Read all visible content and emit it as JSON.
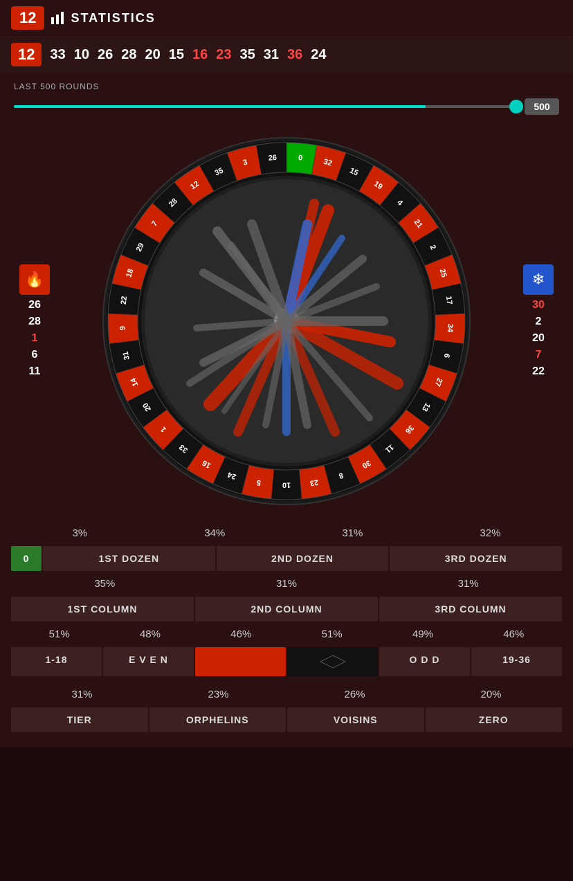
{
  "topbar": {
    "number": "12",
    "stats_icon": "📊",
    "title": "STATISTICS"
  },
  "history": {
    "current": "12",
    "numbers": [
      {
        "value": "33",
        "color": "black"
      },
      {
        "value": "10",
        "color": "black"
      },
      {
        "value": "26",
        "color": "black"
      },
      {
        "value": "28",
        "color": "black"
      },
      {
        "value": "20",
        "color": "black"
      },
      {
        "value": "15",
        "color": "black"
      },
      {
        "value": "16",
        "color": "red"
      },
      {
        "value": "23",
        "color": "red"
      },
      {
        "value": "35",
        "color": "black"
      },
      {
        "value": "31",
        "color": "black"
      },
      {
        "value": "36",
        "color": "red"
      },
      {
        "value": "24",
        "color": "black"
      }
    ]
  },
  "slider": {
    "label": "LAST 500 ROUNDS",
    "value": 500,
    "fill_pct": 82
  },
  "hot_panel": {
    "icon": "🔥",
    "numbers": [
      {
        "value": "26",
        "color": "white"
      },
      {
        "value": "28",
        "color": "white"
      },
      {
        "value": "1",
        "color": "red"
      },
      {
        "value": "6",
        "color": "white"
      },
      {
        "value": "11",
        "color": "white"
      }
    ]
  },
  "cold_panel": {
    "icon": "❄",
    "numbers": [
      {
        "value": "30",
        "color": "red"
      },
      {
        "value": "2",
        "color": "white"
      },
      {
        "value": "20",
        "color": "white"
      },
      {
        "value": "7",
        "color": "red"
      },
      {
        "value": "22",
        "color": "white"
      }
    ]
  },
  "row_pct_1": {
    "values": [
      "3%",
      "34%",
      "31%",
      "32%"
    ]
  },
  "dozens": {
    "zero_label": "0",
    "items": [
      "1ST DOZEN",
      "2ND DOZEN",
      "3RD DOZEN"
    ]
  },
  "row_pct_2": {
    "values": [
      "35%",
      "31%",
      "31%"
    ]
  },
  "columns": {
    "items": [
      "1ST COLUMN",
      "2ND COLUMN",
      "3RD COLUMN"
    ]
  },
  "row_pct_3": {
    "values": [
      "51%",
      "48%",
      "46%",
      "51%",
      "49%",
      "46%"
    ]
  },
  "bets": {
    "items": [
      "1-18",
      "EVEN",
      "RED",
      "BLACK",
      "ODD",
      "19-36"
    ]
  },
  "row_pct_4": {
    "values": [
      "31%",
      "23%",
      "26%",
      "20%"
    ]
  },
  "sections": {
    "items": [
      "TIER",
      "ORPHELINS",
      "VOISINS",
      "ZERO"
    ]
  },
  "wheel": {
    "numbers": [
      "1",
      "20",
      "14",
      "31",
      "9",
      "22",
      "18",
      "29",
      "7",
      "28",
      "12",
      "35",
      "3",
      "26",
      "0",
      "32",
      "15",
      "19",
      "4",
      "21",
      "2",
      "25",
      "17",
      "34",
      "6",
      "27",
      "13",
      "36",
      "11",
      "30",
      "8",
      "23",
      "10",
      "5",
      "24",
      "16",
      "33"
    ]
  }
}
